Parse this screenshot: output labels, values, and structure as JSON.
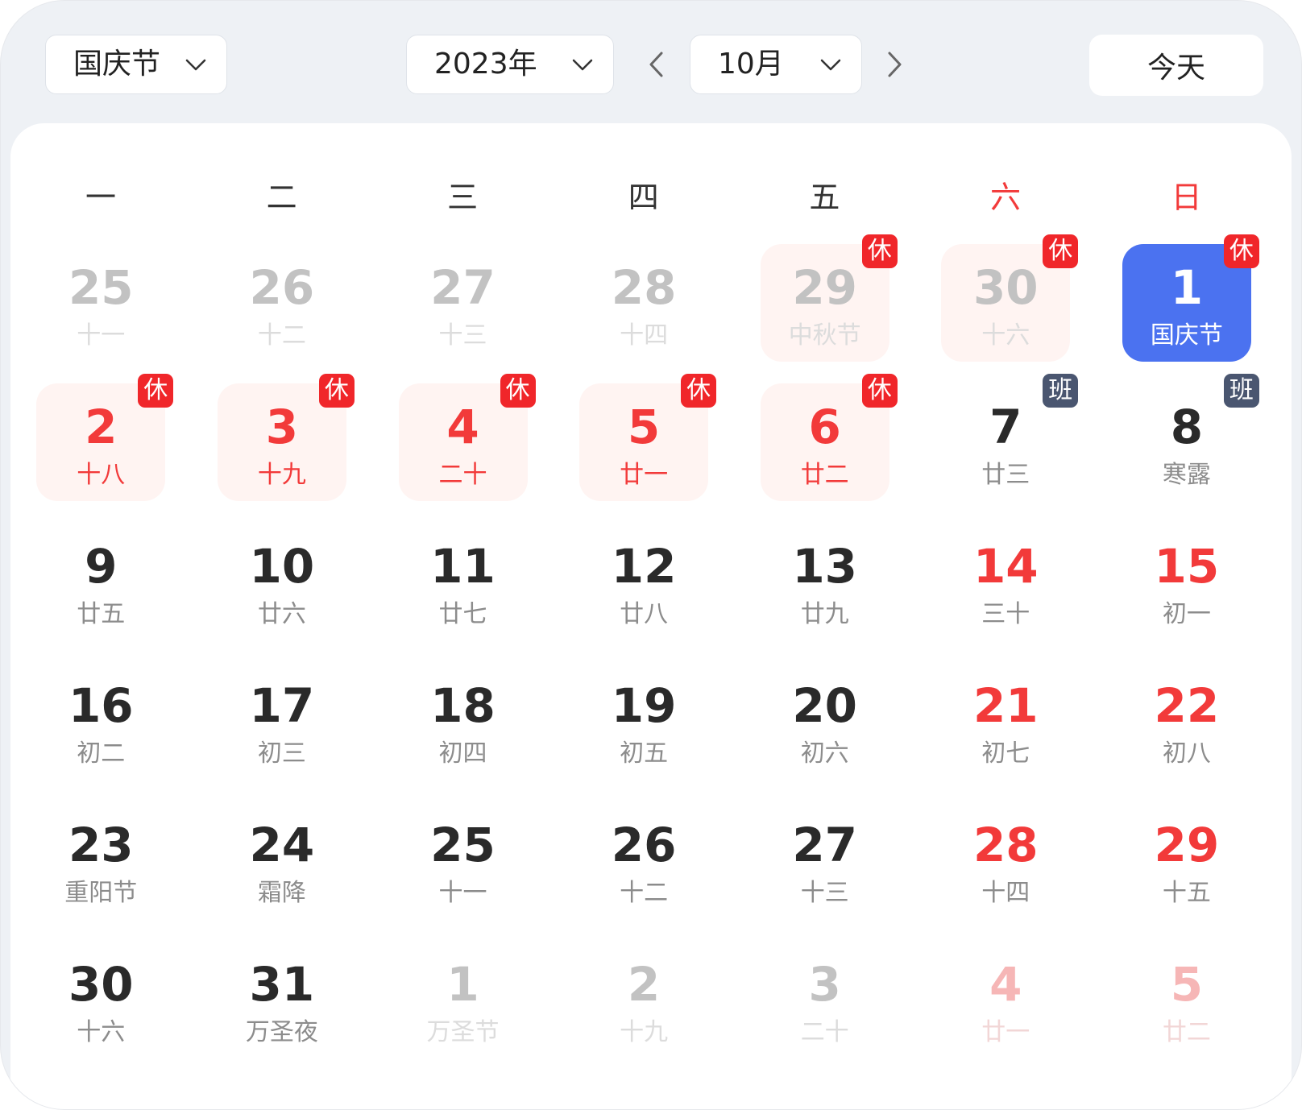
{
  "header": {
    "holiday_select": "国庆节",
    "year_select": "2023年",
    "month_select": "10月",
    "today_label": "今天"
  },
  "weekdays": [
    {
      "label": "一",
      "weekend": false
    },
    {
      "label": "二",
      "weekend": false
    },
    {
      "label": "三",
      "weekend": false
    },
    {
      "label": "四",
      "weekend": false
    },
    {
      "label": "五",
      "weekend": false
    },
    {
      "label": "六",
      "weekend": true
    },
    {
      "label": "日",
      "weekend": true
    }
  ],
  "weeks": [
    [
      {
        "day": "25",
        "lunar": "十一",
        "other": true
      },
      {
        "day": "26",
        "lunar": "十二",
        "other": true
      },
      {
        "day": "27",
        "lunar": "十三",
        "other": true
      },
      {
        "day": "28",
        "lunar": "十四",
        "other": true
      },
      {
        "day": "29",
        "lunar": "中秋节",
        "other": true,
        "rest": true,
        "badge": "休"
      },
      {
        "day": "30",
        "lunar": "十六",
        "other": true,
        "rest": true,
        "badge": "休"
      },
      {
        "day": "1",
        "lunar": "国庆节",
        "selected": true,
        "badge": "休"
      }
    ],
    [
      {
        "day": "2",
        "lunar": "十八",
        "rest": true,
        "badge": "休"
      },
      {
        "day": "3",
        "lunar": "十九",
        "rest": true,
        "badge": "休"
      },
      {
        "day": "4",
        "lunar": "二十",
        "rest": true,
        "badge": "休"
      },
      {
        "day": "5",
        "lunar": "廿一",
        "rest": true,
        "badge": "休"
      },
      {
        "day": "6",
        "lunar": "廿二",
        "rest": true,
        "badge": "休"
      },
      {
        "day": "7",
        "lunar": "廿三",
        "badge": "班",
        "work": true
      },
      {
        "day": "8",
        "lunar": "寒露",
        "badge": "班",
        "work": true
      }
    ],
    [
      {
        "day": "9",
        "lunar": "廿五"
      },
      {
        "day": "10",
        "lunar": "廿六"
      },
      {
        "day": "11",
        "lunar": "廿七"
      },
      {
        "day": "12",
        "lunar": "廿八"
      },
      {
        "day": "13",
        "lunar": "廿九"
      },
      {
        "day": "14",
        "lunar": "三十",
        "weekend": true
      },
      {
        "day": "15",
        "lunar": "初一",
        "weekend": true
      }
    ],
    [
      {
        "day": "16",
        "lunar": "初二"
      },
      {
        "day": "17",
        "lunar": "初三"
      },
      {
        "day": "18",
        "lunar": "初四"
      },
      {
        "day": "19",
        "lunar": "初五"
      },
      {
        "day": "20",
        "lunar": "初六"
      },
      {
        "day": "21",
        "lunar": "初七",
        "weekend": true
      },
      {
        "day": "22",
        "lunar": "初八",
        "weekend": true
      }
    ],
    [
      {
        "day": "23",
        "lunar": "重阳节"
      },
      {
        "day": "24",
        "lunar": "霜降"
      },
      {
        "day": "25",
        "lunar": "十一"
      },
      {
        "day": "26",
        "lunar": "十二"
      },
      {
        "day": "27",
        "lunar": "十三"
      },
      {
        "day": "28",
        "lunar": "十四",
        "weekend": true
      },
      {
        "day": "29",
        "lunar": "十五",
        "weekend": true
      }
    ],
    [
      {
        "day": "30",
        "lunar": "十六"
      },
      {
        "day": "31",
        "lunar": "万圣夜"
      },
      {
        "day": "1",
        "lunar": "万圣节",
        "other": true
      },
      {
        "day": "2",
        "lunar": "十九",
        "other": true
      },
      {
        "day": "3",
        "lunar": "二十",
        "other": true
      },
      {
        "day": "4",
        "lunar": "廿一",
        "other": true,
        "weekend": true
      },
      {
        "day": "5",
        "lunar": "廿二",
        "other": true,
        "weekend": true
      }
    ]
  ]
}
